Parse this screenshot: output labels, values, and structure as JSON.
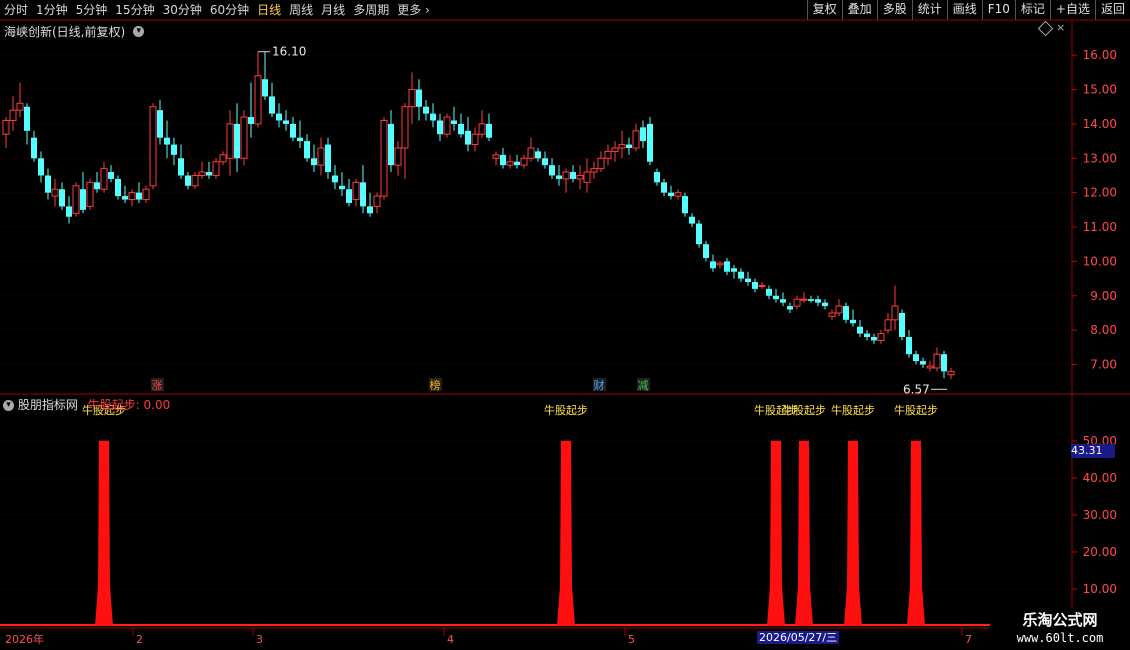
{
  "toolbar": {
    "periods": [
      "分时",
      "1分钟",
      "5分钟",
      "15分钟",
      "30分钟",
      "60分钟",
      "日线",
      "周线",
      "月线",
      "多周期",
      "更多"
    ],
    "active_period": "日线",
    "more_arrow": "›",
    "actions": [
      "复权",
      "叠加",
      "多股",
      "统计",
      "画线",
      "F10",
      "标记",
      "+自选",
      "返回"
    ]
  },
  "main_panel": {
    "stock_label": "海峡创新(日线,前复权)",
    "high_label": "16.10",
    "low_label": "6.57"
  },
  "indicator_panel": {
    "name": "股朋指标网",
    "value_text": "牛股起步: 0.00",
    "signal_text": "牛股起步",
    "current_value": "43.31"
  },
  "events": [
    {
      "label": "涨",
      "color": "#ff4040"
    },
    {
      "label": "榜",
      "color": "#ffb000"
    },
    {
      "label": "财",
      "color": "#4aa0ff"
    },
    {
      "label": "减",
      "color": "#40c040"
    }
  ],
  "footer": {
    "start_label": "2026年",
    "month_labels": [
      "2",
      "3",
      "4",
      "5",
      "7"
    ],
    "cursor_date": "2026/05/27/三",
    "logo_text": "乐淘公式网",
    "logo_url": "www.60lt.com"
  },
  "chart_data": [
    {
      "type": "candlestick",
      "title": "海峡创新(日线,前复权)",
      "ylim": [
        6.2,
        16.5
      ],
      "y_ticks": [
        7.0,
        8.0,
        9.0,
        10.0,
        11.0,
        12.0,
        13.0,
        14.0,
        15.0,
        16.0
      ],
      "up_color": "#ff3b3b",
      "down_color": "#54ffff",
      "series": [
        {
          "name": "K",
          "ohlc": [
            [
              13.7,
              14.2,
              13.3,
              14.1
            ],
            [
              14.1,
              14.8,
              13.8,
              14.4
            ],
            [
              14.4,
              15.2,
              14.2,
              14.6
            ],
            [
              14.5,
              14.6,
              13.4,
              13.8
            ],
            [
              13.6,
              13.8,
              12.9,
              13.0
            ],
            [
              13.0,
              13.2,
              12.3,
              12.5
            ],
            [
              12.5,
              12.7,
              11.8,
              12.0
            ],
            [
              11.9,
              12.4,
              11.6,
              12.1
            ],
            [
              12.1,
              12.3,
              11.5,
              11.6
            ],
            [
              11.6,
              11.9,
              11.1,
              11.3
            ],
            [
              11.4,
              12.3,
              11.3,
              12.2
            ],
            [
              12.1,
              12.6,
              11.4,
              11.5
            ],
            [
              11.6,
              12.4,
              11.5,
              12.3
            ],
            [
              12.3,
              12.6,
              12.0,
              12.1
            ],
            [
              12.1,
              12.9,
              12.0,
              12.7
            ],
            [
              12.6,
              12.8,
              12.3,
              12.4
            ],
            [
              12.4,
              12.5,
              11.8,
              11.9
            ],
            [
              11.9,
              12.2,
              11.7,
              11.8
            ],
            [
              11.8,
              12.1,
              11.6,
              12.0
            ],
            [
              12.0,
              12.3,
              11.7,
              11.8
            ],
            [
              11.8,
              12.2,
              11.7,
              12.1
            ],
            [
              12.2,
              14.6,
              12.1,
              14.5
            ],
            [
              14.4,
              14.7,
              13.4,
              13.6
            ],
            [
              13.6,
              14.1,
              13.0,
              13.4
            ],
            [
              13.4,
              13.6,
              12.8,
              13.1
            ],
            [
              13.0,
              13.4,
              12.4,
              12.5
            ],
            [
              12.5,
              12.6,
              12.1,
              12.2
            ],
            [
              12.2,
              12.6,
              12.1,
              12.5
            ],
            [
              12.5,
              12.9,
              12.4,
              12.6
            ],
            [
              12.6,
              12.9,
              12.4,
              12.5
            ],
            [
              12.5,
              13.0,
              12.4,
              12.9
            ],
            [
              12.9,
              13.2,
              12.8,
              13.1
            ],
            [
              13.0,
              14.4,
              12.5,
              14.0
            ],
            [
              14.0,
              14.6,
              12.6,
              13.0
            ],
            [
              13.0,
              14.4,
              12.8,
              14.2
            ],
            [
              14.2,
              15.2,
              13.6,
              14.0
            ],
            [
              14.0,
              16.1,
              13.9,
              15.4
            ],
            [
              15.3,
              16.1,
              14.7,
              14.8
            ],
            [
              14.8,
              15.2,
              14.2,
              14.3
            ],
            [
              14.3,
              14.6,
              13.9,
              14.1
            ],
            [
              14.1,
              14.4,
              13.8,
              14.0
            ],
            [
              14.0,
              14.2,
              13.5,
              13.6
            ],
            [
              13.6,
              14.1,
              13.3,
              13.5
            ],
            [
              13.5,
              13.7,
              12.9,
              13.0
            ],
            [
              13.0,
              13.4,
              12.6,
              12.8
            ],
            [
              12.8,
              13.6,
              12.5,
              13.3
            ],
            [
              13.4,
              13.6,
              12.4,
              12.6
            ],
            [
              12.5,
              12.8,
              12.1,
              12.3
            ],
            [
              12.2,
              12.6,
              11.9,
              12.1
            ],
            [
              12.1,
              12.4,
              11.6,
              11.7
            ],
            [
              11.8,
              12.4,
              11.6,
              12.3
            ],
            [
              12.3,
              12.8,
              11.4,
              11.6
            ],
            [
              11.6,
              12.0,
              11.3,
              11.4
            ],
            [
              11.6,
              12.0,
              11.4,
              11.9
            ],
            [
              11.9,
              14.2,
              11.8,
              14.1
            ],
            [
              14.0,
              14.4,
              12.6,
              12.8
            ],
            [
              12.8,
              13.5,
              12.5,
              13.3
            ],
            [
              13.3,
              14.6,
              12.4,
              14.5
            ],
            [
              14.5,
              15.5,
              14.0,
              15.0
            ],
            [
              15.0,
              15.3,
              14.1,
              14.5
            ],
            [
              14.5,
              14.7,
              14.1,
              14.3
            ],
            [
              14.3,
              14.6,
              13.9,
              14.1
            ],
            [
              14.1,
              14.3,
              13.5,
              13.7
            ],
            [
              13.7,
              14.3,
              13.6,
              14.2
            ],
            [
              14.1,
              14.5,
              13.8,
              14.0
            ],
            [
              14.0,
              14.3,
              13.6,
              13.7
            ],
            [
              13.8,
              14.2,
              13.2,
              13.4
            ],
            [
              13.4,
              13.9,
              13.2,
              13.7
            ],
            [
              13.7,
              14.4,
              13.6,
              14.0
            ],
            [
              14.0,
              14.3,
              13.5,
              13.6
            ],
            [
              13.0,
              13.2,
              12.8,
              13.1
            ],
            [
              13.1,
              13.3,
              12.7,
              12.8
            ],
            [
              12.8,
              13.1,
              12.7,
              12.9
            ],
            [
              12.9,
              13.1,
              12.7,
              12.8
            ],
            [
              12.8,
              13.1,
              12.7,
              13.0
            ],
            [
              13.0,
              13.6,
              12.9,
              13.3
            ],
            [
              13.2,
              13.3,
              12.9,
              13.0
            ],
            [
              13.0,
              13.2,
              12.7,
              12.8
            ],
            [
              12.8,
              13.0,
              12.4,
              12.5
            ],
            [
              12.5,
              12.8,
              12.2,
              12.4
            ],
            [
              12.4,
              12.7,
              12.0,
              12.6
            ],
            [
              12.6,
              12.8,
              12.3,
              12.4
            ],
            [
              12.4,
              12.8,
              12.1,
              12.5
            ],
            [
              12.3,
              13.0,
              12.0,
              12.6
            ],
            [
              12.6,
              12.9,
              12.4,
              12.7
            ],
            [
              12.7,
              13.2,
              12.6,
              13.0
            ],
            [
              13.0,
              13.4,
              12.8,
              13.2
            ],
            [
              13.2,
              13.5,
              12.9,
              13.3
            ],
            [
              13.3,
              13.8,
              13.0,
              13.4
            ],
            [
              13.4,
              13.6,
              13.1,
              13.3
            ],
            [
              13.3,
              14.0,
              13.2,
              13.8
            ],
            [
              13.9,
              14.1,
              13.3,
              13.5
            ],
            [
              14.0,
              14.2,
              12.8,
              12.9
            ],
            [
              12.6,
              12.7,
              12.2,
              12.3
            ],
            [
              12.3,
              12.4,
              11.9,
              12.0
            ],
            [
              12.0,
              12.2,
              11.8,
              11.9
            ],
            [
              11.9,
              12.1,
              11.8,
              12.0
            ],
            [
              11.9,
              12.0,
              11.3,
              11.4
            ],
            [
              11.3,
              11.4,
              11.0,
              11.1
            ],
            [
              11.1,
              11.2,
              10.4,
              10.5
            ],
            [
              10.5,
              10.6,
              10.0,
              10.1
            ],
            [
              10.0,
              10.2,
              9.7,
              9.8
            ],
            [
              9.9,
              10.0,
              9.8,
              9.95
            ],
            [
              10.0,
              10.1,
              9.6,
              9.7
            ],
            [
              9.8,
              9.9,
              9.5,
              9.7
            ],
            [
              9.7,
              9.8,
              9.4,
              9.5
            ],
            [
              9.5,
              9.7,
              9.3,
              9.4
            ],
            [
              9.4,
              9.5,
              9.1,
              9.2
            ],
            [
              9.3,
              9.4,
              9.2,
              9.3
            ],
            [
              9.2,
              9.3,
              8.9,
              9.0
            ],
            [
              9.0,
              9.2,
              8.8,
              8.9
            ],
            [
              8.9,
              9.1,
              8.7,
              8.8
            ],
            [
              8.7,
              8.8,
              8.5,
              8.6
            ],
            [
              8.7,
              9.0,
              8.6,
              8.9
            ],
            [
              8.9,
              9.1,
              8.8,
              8.9
            ],
            [
              8.9,
              9.0,
              8.8,
              8.85
            ],
            [
              8.9,
              9.0,
              8.7,
              8.8
            ],
            [
              8.8,
              8.9,
              8.6,
              8.7
            ],
            [
              8.4,
              8.6,
              8.3,
              8.5
            ],
            [
              8.5,
              8.9,
              8.4,
              8.7
            ],
            [
              8.7,
              8.8,
              8.2,
              8.3
            ],
            [
              8.3,
              8.6,
              8.1,
              8.2
            ],
            [
              8.1,
              8.3,
              7.8,
              7.9
            ],
            [
              7.9,
              8.0,
              7.7,
              7.8
            ],
            [
              7.8,
              7.9,
              7.6,
              7.7
            ],
            [
              7.7,
              8.0,
              7.6,
              7.9
            ],
            [
              8.0,
              8.5,
              7.9,
              8.3
            ],
            [
              8.3,
              9.3,
              8.0,
              8.7
            ],
            [
              8.5,
              8.6,
              7.7,
              7.8
            ],
            [
              7.8,
              8.0,
              7.2,
              7.3
            ],
            [
              7.3,
              7.4,
              7.0,
              7.1
            ],
            [
              7.1,
              7.2,
              6.9,
              7.0
            ],
            [
              6.9,
              7.1,
              6.8,
              6.95
            ],
            [
              6.9,
              7.5,
              6.8,
              7.3
            ],
            [
              7.3,
              7.4,
              6.6,
              6.8
            ],
            [
              6.7,
              6.9,
              6.57,
              6.8
            ]
          ]
        }
      ]
    },
    {
      "type": "bar",
      "title": "股朋指标网",
      "ylim": [
        0,
        57
      ],
      "y_ticks": [
        10.0,
        20.0,
        30.0,
        40.0,
        50.0
      ],
      "series": [
        {
          "name": "牛股起步",
          "values": [
            0,
            0,
            0,
            0,
            0,
            0,
            0,
            0,
            0,
            0,
            0,
            0,
            0,
            0,
            0,
            0,
            0,
            0,
            0,
            0,
            0,
            0,
            0,
            0,
            0,
            0,
            0,
            0,
            0,
            0,
            0,
            0,
            0,
            0,
            0,
            0,
            0,
            0,
            0,
            0,
            0,
            0,
            0,
            0,
            0,
            0,
            0,
            0,
            0,
            0,
            0,
            0,
            0,
            0,
            0,
            0,
            0,
            0,
            0,
            0,
            0,
            0,
            0,
            0,
            0,
            0,
            0,
            0,
            0,
            0,
            0,
            0,
            0,
            0,
            0,
            0,
            0,
            0,
            0,
            0,
            0,
            0,
            0,
            0,
            0,
            0,
            0,
            0,
            0,
            0,
            0,
            0,
            0,
            0,
            0,
            0,
            0,
            0,
            0,
            0,
            0,
            0,
            0,
            0,
            0,
            0,
            0,
            0,
            0,
            0,
            0,
            0,
            0,
            0,
            0,
            0,
            0,
            0,
            0,
            0,
            0,
            0,
            0,
            0,
            0,
            0,
            0,
            0,
            0,
            0,
            0,
            0,
            0,
            0,
            0,
            0,
            0,
            0,
            0,
            0,
            0
          ]
        }
      ],
      "signals": [
        {
          "bar": 14,
          "value": 50
        },
        {
          "bar": 80,
          "value": 50
        },
        {
          "bar": 110,
          "value": 50
        },
        {
          "bar": 114,
          "value": 50
        },
        {
          "bar": 121,
          "value": 50
        },
        {
          "bar": 130,
          "value": 50
        }
      ]
    }
  ]
}
